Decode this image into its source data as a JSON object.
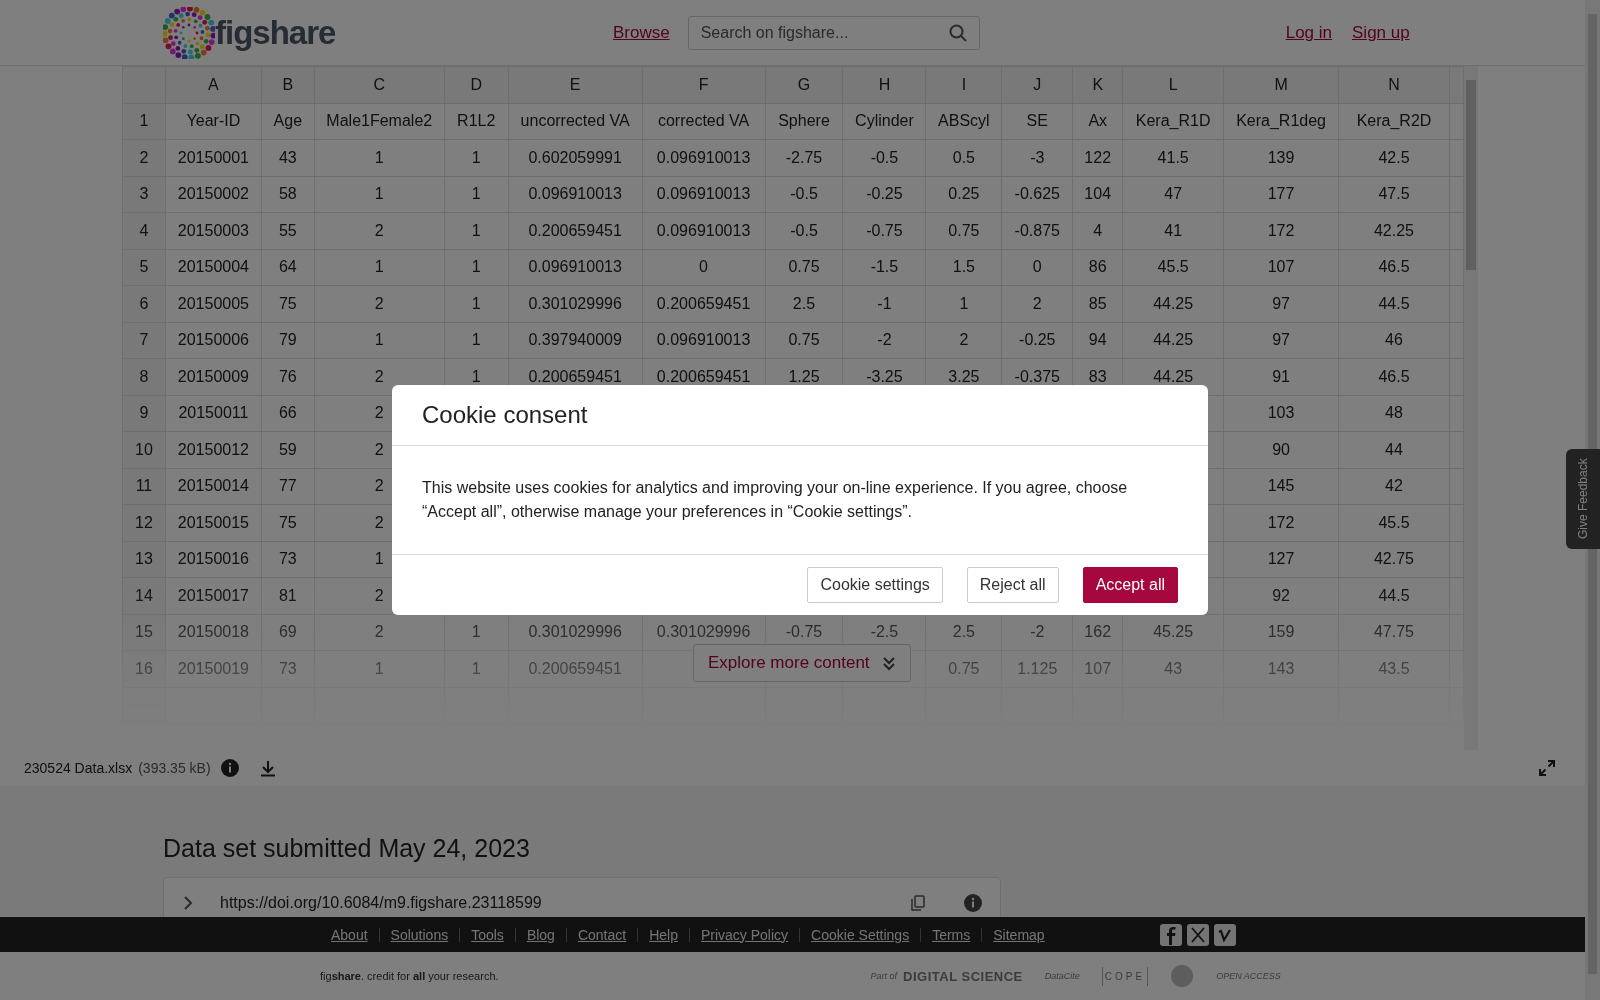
{
  "header": {
    "logo": "figshare",
    "nav_link": "Browse",
    "search": {
      "placeholder": "Search on figshare..."
    },
    "auth_links": [
      "Log in",
      "Sign up"
    ]
  },
  "spreadsheet": {
    "columns": [
      "A",
      "B",
      "C",
      "D",
      "E",
      "F",
      "G",
      "H",
      "I",
      "J",
      "K",
      "L",
      "M",
      "N"
    ],
    "rows": [
      {
        "number": "1",
        "cells": [
          "Year-ID",
          "Age",
          "Male1Female2",
          "R1L2",
          "uncorrected VA",
          "corrected VA",
          "Sphere",
          "Cylinder",
          "ABScyl",
          "SE",
          "Ax",
          "Kera_R1D",
          "Kera_R1deg",
          "Kera_R2D"
        ]
      },
      {
        "number": "2",
        "cells": [
          "20150001",
          "43",
          "1",
          "1",
          "0.602059991",
          "0.096910013",
          "-2.75",
          "-0.5",
          "0.5",
          "-3",
          "122",
          "41.5",
          "139",
          "42.5"
        ]
      },
      {
        "number": "3",
        "cells": [
          "20150002",
          "58",
          "1",
          "1",
          "0.096910013",
          "0.096910013",
          "-0.5",
          "-0.25",
          "0.25",
          "-0.625",
          "104",
          "47",
          "177",
          "47.5"
        ]
      },
      {
        "number": "4",
        "cells": [
          "20150003",
          "55",
          "2",
          "1",
          "0.200659451",
          "0.096910013",
          "-0.5",
          "-0.75",
          "0.75",
          "-0.875",
          "4",
          "41",
          "172",
          "42.25"
        ]
      },
      {
        "number": "5",
        "cells": [
          "20150004",
          "64",
          "1",
          "1",
          "0.096910013",
          "0",
          "0.75",
          "-1.5",
          "1.5",
          "0",
          "86",
          "45.5",
          "107",
          "46.5"
        ]
      },
      {
        "number": "6",
        "cells": [
          "20150005",
          "75",
          "2",
          "1",
          "0.301029996",
          "0.200659451",
          "2.5",
          "-1",
          "1",
          "2",
          "85",
          "44.25",
          "97",
          "44.5"
        ]
      },
      {
        "number": "7",
        "cells": [
          "20150006",
          "79",
          "1",
          "1",
          "0.397940009",
          "0.096910013",
          "0.75",
          "-2",
          "2",
          "-0.25",
          "94",
          "44.25",
          "97",
          "46"
        ]
      },
      {
        "number": "8",
        "cells": [
          "20150009",
          "76",
          "2",
          "1",
          "0.200659451",
          "0.200659451",
          "1.25",
          "-3.25",
          "3.25",
          "-0.375",
          "83",
          "44.25",
          "91",
          "46.5"
        ]
      },
      {
        "number": "9",
        "cells": [
          "20150011",
          "66",
          "2",
          null,
          null,
          null,
          null,
          null,
          null,
          null,
          null,
          null,
          "103",
          "48"
        ]
      },
      {
        "number": "10",
        "cells": [
          "20150012",
          "59",
          "2",
          null,
          null,
          null,
          null,
          null,
          null,
          null,
          null,
          null,
          "90",
          "44"
        ]
      },
      {
        "number": "11",
        "cells": [
          "20150014",
          "77",
          "2",
          null,
          null,
          null,
          null,
          null,
          null,
          null,
          null,
          null,
          "145",
          "42"
        ]
      },
      {
        "number": "12",
        "cells": [
          "20150015",
          "75",
          "2",
          null,
          null,
          null,
          null,
          null,
          null,
          null,
          null,
          null,
          "172",
          "45.5"
        ]
      },
      {
        "number": "13",
        "cells": [
          "20150016",
          "73",
          "1",
          null,
          null,
          null,
          null,
          null,
          null,
          null,
          null,
          null,
          "127",
          "42.75"
        ]
      },
      {
        "number": "14",
        "cells": [
          "20150017",
          "81",
          "2",
          null,
          null,
          null,
          null,
          null,
          null,
          null,
          null,
          null,
          "92",
          "44.5"
        ]
      },
      {
        "number": "15",
        "cells": [
          "20150018",
          "69",
          "2",
          "1",
          "0.301029996",
          "0.301029996",
          "-0.75",
          "-2.5",
          "2.5",
          "-2",
          "162",
          "45.25",
          "159",
          "47.75"
        ]
      },
      {
        "number": "16",
        "cells": [
          "20150019",
          "73",
          "1",
          "1",
          "0.200659451",
          null,
          null,
          null,
          "0.75",
          "1.125",
          "107",
          "43",
          "143",
          "43.5"
        ]
      }
    ]
  },
  "explore_button": "Explore more content",
  "file_bar": {
    "name": "230524 Data.xlsx",
    "size": "(393.35 kB)"
  },
  "section": {
    "title": "Data set submitted May 24, 2023",
    "doi": "https://doi.org/10.6084/m9.figshare.23118599"
  },
  "feedback_tab": "Give Feedback",
  "footer": {
    "links": [
      "About",
      "Solutions",
      "Tools",
      "Blog",
      "Contact",
      "Help",
      "Privacy Policy",
      "Cookie Settings",
      "Terms",
      "Sitemap"
    ],
    "tagline": "fig**share**. credit for **all** your research.",
    "partners": [
      "Part of",
      "DIGITAL SCIENCE",
      "DataCite",
      "COPE",
      "OPEN ACCESS"
    ]
  },
  "cookie_dialog": {
    "title": "Cookie consent",
    "text": "This website uses cookies for analytics and improving your on-line experience. If you agree, choose “Accept all”, otherwise manage your preferences in “Cookie settings”.",
    "buttons": [
      {
        "label": "Cookie settings",
        "kind": "secondary"
      },
      {
        "label": "Reject all",
        "kind": "secondary"
      },
      {
        "label": "Accept all",
        "kind": "primary"
      }
    ]
  }
}
